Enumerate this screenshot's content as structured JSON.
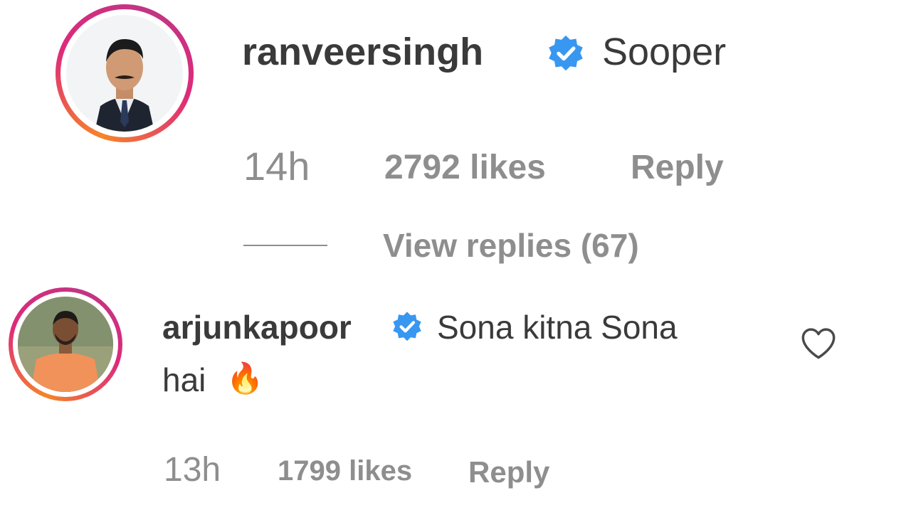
{
  "comments": [
    {
      "username": "ranveersingh",
      "verified": true,
      "text": "Sooper",
      "time": "14h",
      "likes": "2792 likes",
      "reply_label": "Reply",
      "view_replies": "View replies (67)"
    },
    {
      "username": "arjunkapoor",
      "verified": true,
      "text_line1": "Sona kitna Sona",
      "text_line2": "hai",
      "emoji": "🔥",
      "time": "13h",
      "likes": "1799 likes",
      "reply_label": "Reply"
    }
  ],
  "icons": {
    "verified": "verified-badge-icon",
    "like": "heart-icon"
  },
  "colors": {
    "verified_blue": "#3897f0",
    "text_dark": "#3a3a3a",
    "text_muted": "#8e8e8e",
    "story_ring_start": "#f58529",
    "story_ring_end": "#dd2a7b"
  }
}
